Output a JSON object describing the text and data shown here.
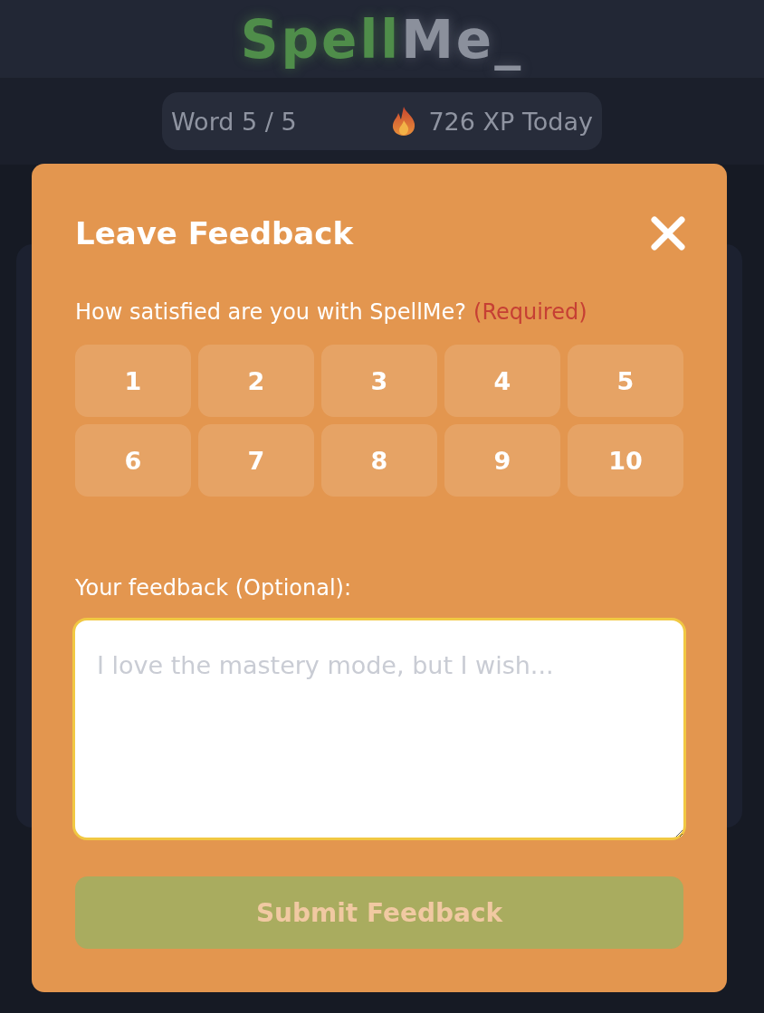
{
  "header": {
    "logo": {
      "first": "Spell",
      "second": "Me_"
    }
  },
  "progress": {
    "word": "Word 5 / 5",
    "xp": "726 XP Today"
  },
  "dialog": {
    "title": "Leave Feedback",
    "rating": {
      "question": "How satisfied are you with SpellMe?",
      "required": "(Required)",
      "options": [
        {
          "label": "1",
          "selected": false
        },
        {
          "label": "2",
          "selected": false
        },
        {
          "label": "3",
          "selected": false
        },
        {
          "label": "4",
          "selected": false
        },
        {
          "label": "5",
          "selected": false
        },
        {
          "label": "6",
          "selected": false
        },
        {
          "label": "7",
          "selected": false
        },
        {
          "label": "8",
          "selected": false
        },
        {
          "label": "9",
          "selected": false
        },
        {
          "label": "10",
          "selected": false
        }
      ]
    },
    "feedback": {
      "label": "Your feedback (Optional):",
      "placeholder": "I love the mastery mode, but I wish...",
      "focused": true
    },
    "submit": {
      "label": "Submit Feedback",
      "disabled": true
    }
  }
}
